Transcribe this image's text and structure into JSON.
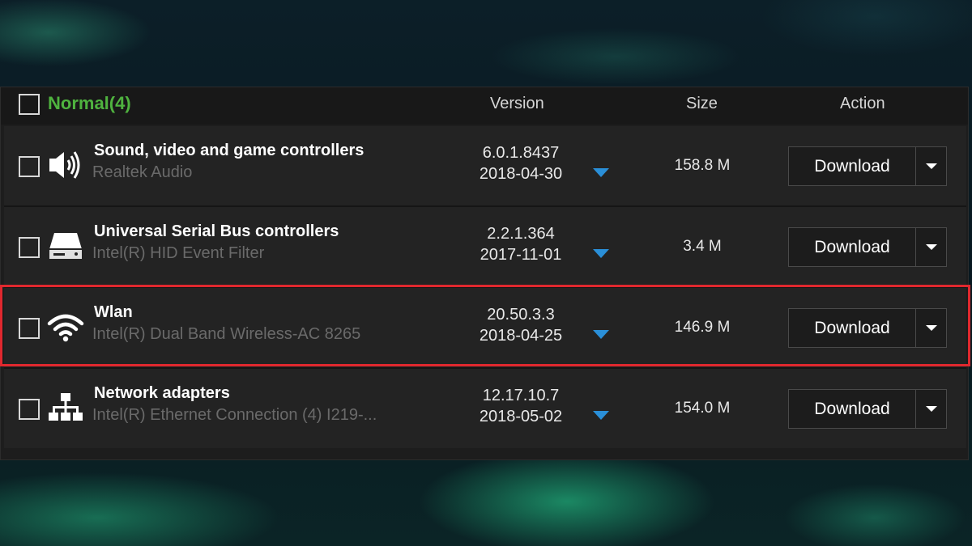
{
  "header": {
    "group_title": "Normal(4)",
    "col_version": "Version",
    "col_size": "Size",
    "col_action": "Action"
  },
  "rows": [
    {
      "title": "Sound, video and game controllers",
      "subtitle": "Realtek Audio",
      "version": "6.0.1.8437",
      "date": "2018-04-30",
      "size": "158.8 M",
      "action": "Download",
      "icon": "speaker-icon"
    },
    {
      "title": "Universal Serial Bus controllers",
      "subtitle": "Intel(R) HID Event Filter",
      "version": "2.2.1.364",
      "date": "2017-11-01",
      "size": "3.4 M",
      "action": "Download",
      "icon": "drive-icon"
    },
    {
      "title": "Wlan",
      "subtitle": "Intel(R) Dual Band Wireless-AC 8265",
      "version": "20.50.3.3",
      "date": "2018-04-25",
      "size": "146.9 M",
      "action": "Download",
      "icon": "wifi-icon",
      "highlighted": true
    },
    {
      "title": "Network adapters",
      "subtitle": "Intel(R) Ethernet Connection (4) I219-...",
      "version": "12.17.10.7",
      "date": "2018-05-02",
      "size": "154.0 M",
      "action": "Download",
      "icon": "network-icon"
    }
  ],
  "colors": {
    "group_title": "#4fb33f",
    "highlight": "#e0282e",
    "caret": "#2a8fd8"
  }
}
